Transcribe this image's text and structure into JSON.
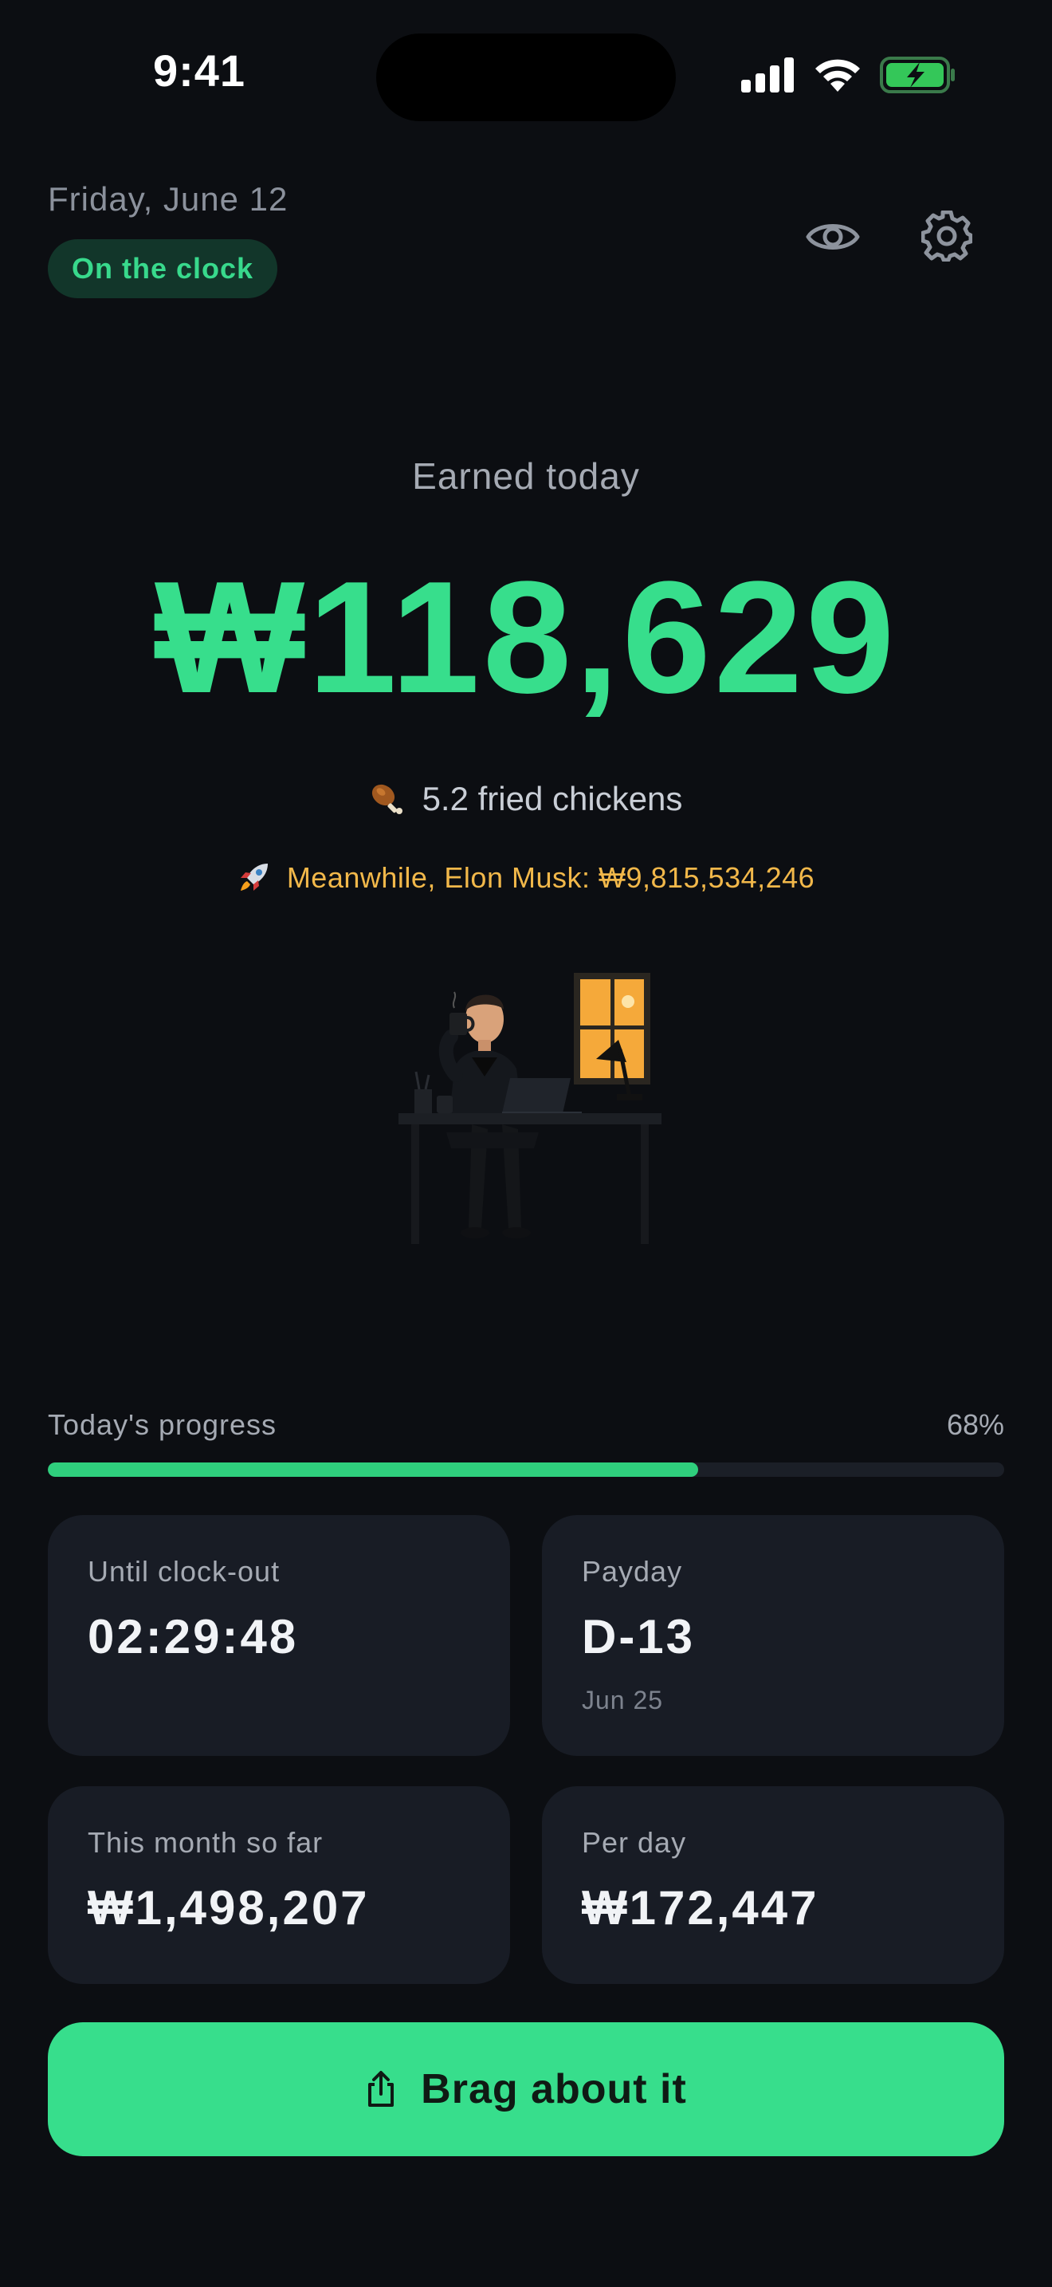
{
  "status_bar": {
    "time": "9:41"
  },
  "header": {
    "date": "Friday, June 12",
    "status_badge": "On the clock"
  },
  "hero": {
    "earned_label": "Earned today",
    "amount": "₩118,629",
    "chicken_text": "5.2 fried chickens",
    "musk_text": "Meanwhile, Elon Musk: ₩9,815,534,246"
  },
  "progress": {
    "label": "Today's progress",
    "percent_text": "68%",
    "value": 0.68
  },
  "cards": {
    "clock_out": {
      "label": "Until clock-out",
      "value": "02:29:48"
    },
    "payday": {
      "label": "Payday",
      "value": "D-13",
      "sub": "Jun 25"
    },
    "month": {
      "label": "This month so far",
      "value": "₩1,498,207"
    },
    "per_day": {
      "label": "Per day",
      "value": "₩172,447"
    }
  },
  "cta": {
    "label": "Brag about it"
  },
  "icons": {
    "eye": "eye-icon",
    "settings": "gear-icon",
    "chicken": "chicken-leg-icon",
    "rocket": "rocket-icon",
    "share": "share-icon"
  },
  "colors": {
    "accent": "#37de8c",
    "musk": "#f2b84a",
    "background": "#0c0e12",
    "card": "#181c25"
  }
}
